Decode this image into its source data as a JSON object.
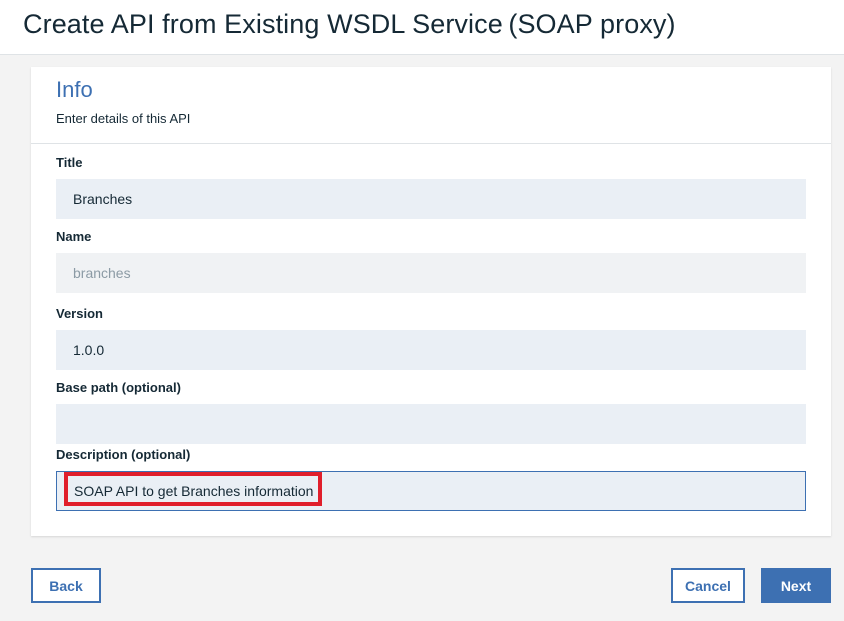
{
  "header": {
    "title": "Create API from Existing WSDL Service (SOAP proxy)"
  },
  "info": {
    "title": "Info",
    "subtitle": "Enter details of this API"
  },
  "fields": {
    "title": {
      "label": "Title",
      "value": "Branches"
    },
    "name": {
      "label": "Name",
      "value": "branches"
    },
    "version": {
      "label": "Version",
      "value": "1.0.0"
    },
    "base_path": {
      "label": "Base path (optional)",
      "value": ""
    },
    "description": {
      "label": "Description (optional)",
      "value": "SOAP API to get Branches information"
    }
  },
  "actions": {
    "back": "Back",
    "cancel": "Cancel",
    "next": "Next"
  },
  "colors": {
    "accent": "#3d70b2",
    "highlight": "#e01e2b"
  }
}
